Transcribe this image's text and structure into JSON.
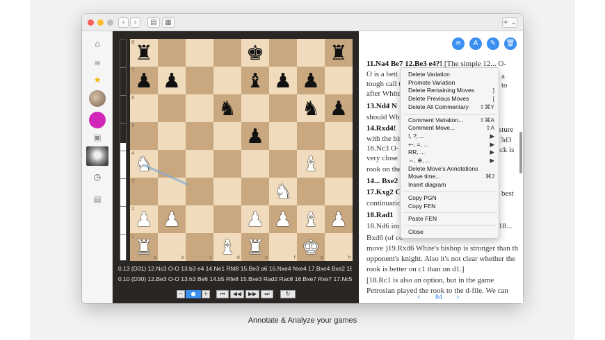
{
  "caption": "Annotate & Analyze your games",
  "titlebar": {
    "nav_back": "‹",
    "nav_forward": "›",
    "view_icon_1": "▤",
    "view_icon_2": "▦",
    "add_menu": "+ ⌄"
  },
  "sidebar": {
    "icons": [
      "house-icon",
      "list-icon",
      "star-icon",
      "avatar",
      "avatar",
      "inbox-icon",
      "avatar",
      "clock-icon",
      "book-icon"
    ],
    "glyphs": [
      "⌂",
      "≡",
      "★",
      "",
      "",
      "▣",
      "",
      "◷",
      "▤"
    ]
  },
  "board": {
    "rows": [
      [
        "",
        "",
        "",
        "",
        "",
        "",
        "",
        ""
      ],
      [
        "r",
        "",
        "",
        "",
        "k",
        "",
        "",
        "r"
      ],
      [
        "p",
        "p",
        "",
        "",
        "b",
        "p",
        "p",
        ""
      ],
      [
        "",
        "",
        "",
        "n",
        "",
        "",
        "n",
        "p"
      ],
      [
        "",
        "",
        "",
        "",
        "p",
        "",
        "",
        ""
      ],
      [
        "N",
        "",
        "",
        "",
        "",
        "",
        "B",
        ""
      ],
      [
        "",
        "",
        "",
        "",
        "",
        "N",
        "",
        ""
      ],
      [
        "P",
        "P",
        "",
        "",
        "P",
        "P",
        "B",
        "P"
      ],
      [
        "R",
        "",
        "",
        "B",
        "R",
        "",
        "K",
        ""
      ]
    ],
    "ranks": [
      "8",
      "7",
      "6",
      "5",
      "4",
      "3",
      "2",
      "1"
    ],
    "files": [
      "a",
      "b",
      "c",
      "d",
      "e",
      "f",
      "g",
      "h"
    ],
    "evaluation_fraction_black": 0.47
  },
  "engine_lines": [
    "0.13 (D31) 12.Nc3 O-O 13.b3 e4 14.Ne1 Rfd8 15.Be3 a6 16.Nxe4 Nxe4 17.Bxe4 Bxe2 18.Rx...",
    "0.10 (D30) 12.Be3 O-O 13.h3 Be6 14.b5 Rfe8 15.Bxe3 Rad2 Rac8 16.Bxe7 Rxe7 17.Nc5 Bf5 18.Nc..."
  ],
  "controls": [
    "−",
    "●",
    "+",
    "⏮",
    "◀◀",
    "▶▶",
    "⏭",
    "↻"
  ],
  "notation": {
    "top_icons": [
      "list-icon",
      "annotate-icon",
      "pen-icon",
      "trash-icon"
    ],
    "top_glyphs": [
      "≡",
      "A",
      "✎",
      "🗑"
    ],
    "lines": [
      {
        "text": "11.Na4 Be7 12.Be3 e4?! [The simple 12... O-",
        "bold": false,
        "boldlead": "11.Na4 Be7 12.Be3 e4?!"
      },
      {
        "text": "O is a bett",
        "bold": false
      },
      {
        "text": "tough call t",
        "bold": false
      },
      {
        "text": "after White",
        "bold": false
      },
      {
        "text": "13.Nd4 N",
        "bold": true
      },
      {
        "text": "should Whi",
        "bold": false
      },
      {
        "text": "14.Rxd4!",
        "bold": true
      },
      {
        "text": "with the bis",
        "bold": false
      },
      {
        "text": "16.Nc3 O-",
        "bold": false
      },
      {
        "text": "very close a",
        "bold": false
      },
      {
        "text": "rook on the",
        "bold": false
      },
      {
        "text": "14... Bxe2",
        "bold": true
      },
      {
        "text": "17.Kxg2 C",
        "bold": true
      },
      {
        "text": "continuatio",
        "bold": false
      },
      {
        "text": "18.Rad1",
        "bold": true
      },
      {
        "text": "18.Nd6  im",
        "bold": false
      },
      {
        "text": "Bxd6 (of co",
        "bold": false
      },
      {
        "text": "move )19.Rxd6 White's bishop is stronger than the",
        "bold": false
      },
      {
        "text": "opponent's knight. Also it's not clear whether the",
        "bold": false
      },
      {
        "text": "rook is better on c1 than on d1.]",
        "bold": false
      },
      {
        "text": "[18.Rc1 is also an option, but in the game",
        "bold": false
      },
      {
        "text": "Petrosian played the rook to the d-file. We can",
        "bold": false
      }
    ],
    "right_fragments": [
      "a",
      "to",
      "sture",
      "3d3",
      "ack is",
      "best",
      "18...",
      ""
    ],
    "page_prev": "‹",
    "page_number": "84",
    "page_next": "›"
  },
  "context_menu": {
    "items": [
      {
        "label": "Delete Variation",
        "shortcut": ""
      },
      {
        "label": "Promote Variation",
        "shortcut": ""
      },
      {
        "label": "Delete Remaining Moves",
        "shortcut": "]"
      },
      {
        "label": "Delete Previous Moves",
        "shortcut": "["
      },
      {
        "label": "Delete All Commentary",
        "shortcut": "⇧⌘Y"
      },
      {
        "label": "---"
      },
      {
        "label": "Comment Variation...",
        "shortcut": "⇧⌘A"
      },
      {
        "label": "Comment Move...",
        "shortcut": "⇧A"
      },
      {
        "label": "!, ?, ...",
        "shortcut": "▶"
      },
      {
        "label": "+-, =, ...",
        "shortcut": "▶"
      },
      {
        "label": "RR, ...",
        "shortcut": "▶"
      },
      {
        "label": "⇔, ⊕, ...",
        "shortcut": "▶"
      },
      {
        "label": "Delete Move's Annotations",
        "shortcut": ""
      },
      {
        "label": "Move time...",
        "shortcut": "⌘J"
      },
      {
        "label": "Insert diagram",
        "shortcut": ""
      },
      {
        "label": "---"
      },
      {
        "label": "Copy PGN",
        "shortcut": ""
      },
      {
        "label": "Copy FEN",
        "shortcut": ""
      },
      {
        "label": "---"
      },
      {
        "label": "Paste FEN",
        "shortcut": ""
      },
      {
        "label": "---"
      },
      {
        "label": "Close",
        "shortcut": ""
      }
    ]
  },
  "colors": {
    "accent": "#3a8ff0",
    "board_light": "#f0dcbc",
    "board_dark": "#c9a77f",
    "panel_dark": "#2a2624",
    "highlight_move": "#b8d4f0"
  }
}
